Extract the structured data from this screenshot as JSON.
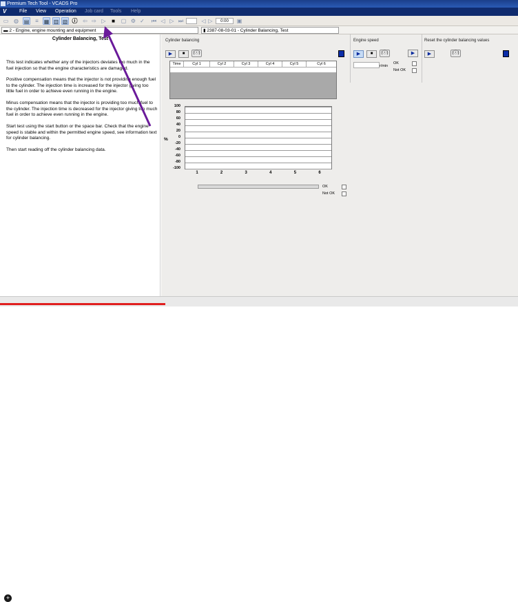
{
  "window": {
    "title": "Premium Tech Tool - VCADS Pro"
  },
  "menu": {
    "logo": "V",
    "items": [
      {
        "label": "File",
        "disabled": false
      },
      {
        "label": "View",
        "disabled": false
      },
      {
        "label": "Operation",
        "disabled": false
      },
      {
        "label": "Job card",
        "disabled": true
      },
      {
        "label": "Tools",
        "disabled": true
      },
      {
        "label": "Help",
        "disabled": true
      }
    ]
  },
  "toolbar": {
    "time": "0:00"
  },
  "path": {
    "left": "2 - Engine, engine mounting and equipment",
    "right": "2387-08-03-01 - Cylinder Balancing, Test"
  },
  "info": {
    "heading": "Cylinder Balancing, Test",
    "paragraphs": [
      "This test indicates whether any of the injectors deviates too much in the fuel injection so that the engine characteristics are damaged.",
      "Positive compensation means that the injector is not providing enough fuel to the cylinder. The injection time is increased for the injector giving too little fuel in order to achieve even running in the engine.",
      "Minus compensation means that the injector is providing too much fuel to the cylinder. The injection time is decreased for the injector giving too much fuel in order to achieve even running in the engine.",
      "Start test using the start button or the space bar. Check that the engine speed is stable and within the permitted engine speed, see information text for cylinder balancing.",
      "Then start reading off the cylinder balancing data."
    ]
  },
  "balancing": {
    "title": "Cylinder balancing",
    "columns": [
      "Time",
      "Cyl 1",
      "Cyl 2",
      "Cyl 3",
      "Cyl 4",
      "Cyl 5",
      "Cyl 6"
    ],
    "ok_label": "OK",
    "notok_label": "Not OK"
  },
  "engine_speed": {
    "title": "Engine speed",
    "unit": "r/min",
    "ok_label": "OK",
    "notok_label": "Not OK"
  },
  "reset": {
    "title": "Reset the cylinder balancing values"
  },
  "chart_data": {
    "type": "bar",
    "categories": [
      "1",
      "2",
      "3",
      "4",
      "5",
      "6"
    ],
    "yticks": [
      "100",
      "80",
      "60",
      "40",
      "20",
      "0",
      "-20",
      "-40",
      "-60",
      "-80",
      "-100"
    ],
    "ylabel": "%",
    "ylim": [
      -100,
      100
    ],
    "values": [],
    "grid": true
  }
}
